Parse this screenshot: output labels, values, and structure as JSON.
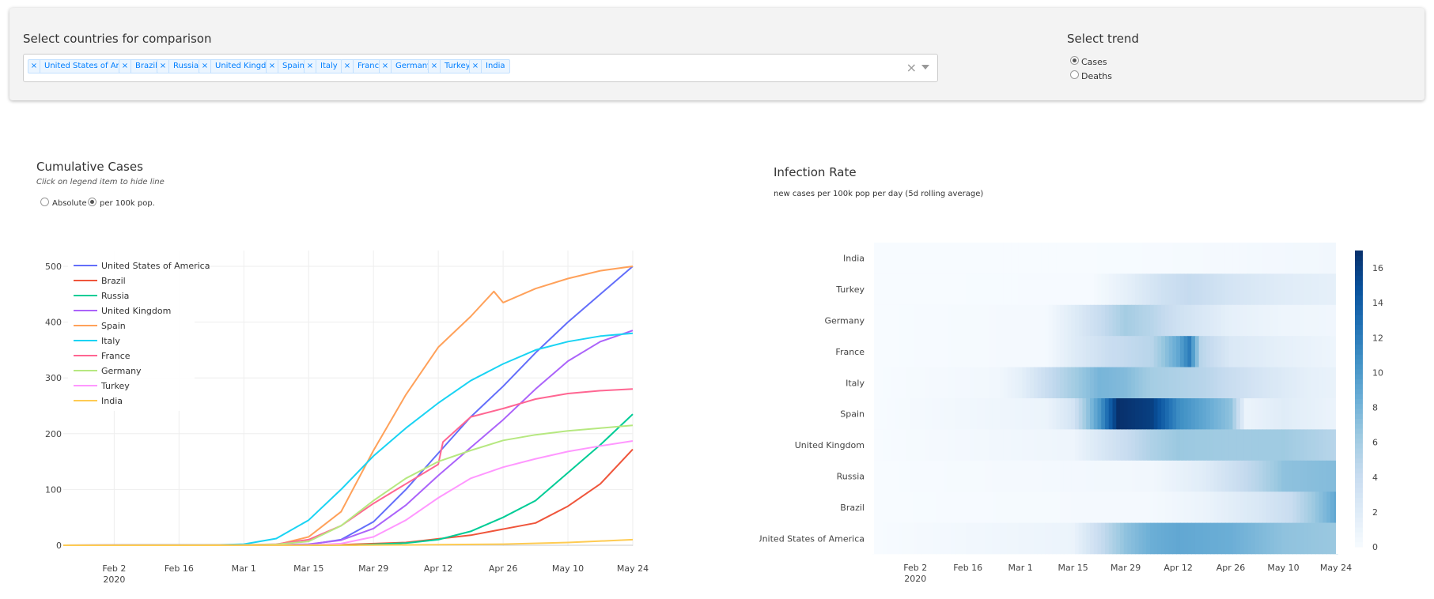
{
  "controls": {
    "country_label": "Select countries for comparison",
    "countries": [
      "United States of America",
      "Brazil",
      "Russia",
      "United Kingdom",
      "Spain",
      "Italy",
      "France",
      "Germany",
      "Turkey",
      "India"
    ],
    "tag_remove": "×",
    "clear_symbol": "×",
    "trend_label": "Select trend",
    "trend_options": [
      "Cases",
      "Deaths"
    ],
    "trend_selected": "Cases"
  },
  "left": {
    "title": "Cumulative Cases",
    "hint": "Click on legend item to hide line",
    "scale_options": [
      "Absolute",
      "per 100k pop."
    ],
    "scale_selected": "per 100k pop."
  },
  "right": {
    "title": "Infection Rate",
    "subtitle": "new cases per 100k pop per day (5d rolling average)"
  },
  "colors": {
    "United States of America": "#636efa",
    "Brazil": "#ef553b",
    "Russia": "#00cc96",
    "United Kingdom": "#ab63fa",
    "Spain": "#ffa15a",
    "Italy": "#19d3f3",
    "France": "#ff6692",
    "Germany": "#b6e880",
    "Turkey": "#ff97ff",
    "India": "#fecb52"
  },
  "chart_data": [
    {
      "type": "line",
      "title": "",
      "xlabel": "",
      "ylabel": "",
      "x_start": "2020-01-22",
      "x_end": "2020-05-24",
      "xticks": [
        "Feb 2",
        "Feb 16",
        "Mar 1",
        "Mar 15",
        "Mar 29",
        "Apr 12",
        "Apr 26",
        "May 10",
        "May 24"
      ],
      "xtick_dates": [
        "2020-02-02",
        "2020-02-16",
        "2020-03-01",
        "2020-03-15",
        "2020-03-29",
        "2020-04-12",
        "2020-04-26",
        "2020-05-10",
        "2020-05-24"
      ],
      "xtick_sublabel": "2020",
      "ylim": [
        0,
        520
      ],
      "yticks": [
        0,
        100,
        200,
        300,
        400,
        500
      ],
      "legend_position": "top-left",
      "series": [
        {
          "name": "United States of America",
          "points": [
            [
              "2020-01-22",
              0
            ],
            [
              "2020-03-10",
              0.3
            ],
            [
              "2020-03-15",
              1
            ],
            [
              "2020-03-22",
              10
            ],
            [
              "2020-03-29",
              42
            ],
            [
              "2020-04-05",
              100
            ],
            [
              "2020-04-12",
              165
            ],
            [
              "2020-04-19",
              230
            ],
            [
              "2020-04-26",
              285
            ],
            [
              "2020-05-03",
              345
            ],
            [
              "2020-05-10",
              400
            ],
            [
              "2020-05-17",
              450
            ],
            [
              "2020-05-24",
              500
            ]
          ]
        },
        {
          "name": "Brazil",
          "points": [
            [
              "2020-01-22",
              0
            ],
            [
              "2020-03-20",
              0.3
            ],
            [
              "2020-04-05",
              5
            ],
            [
              "2020-04-19",
              18
            ],
            [
              "2020-05-03",
              40
            ],
            [
              "2020-05-10",
              70
            ],
            [
              "2020-05-17",
              110
            ],
            [
              "2020-05-24",
              172
            ]
          ]
        },
        {
          "name": "Russia",
          "points": [
            [
              "2020-01-22",
              0
            ],
            [
              "2020-03-25",
              0.3
            ],
            [
              "2020-04-05",
              4
            ],
            [
              "2020-04-12",
              10
            ],
            [
              "2020-04-19",
              25
            ],
            [
              "2020-04-26",
              50
            ],
            [
              "2020-05-03",
              80
            ],
            [
              "2020-05-10",
              130
            ],
            [
              "2020-05-17",
              180
            ],
            [
              "2020-05-24",
              235
            ]
          ]
        },
        {
          "name": "United Kingdom",
          "points": [
            [
              "2020-01-22",
              0
            ],
            [
              "2020-03-08",
              0.5
            ],
            [
              "2020-03-15",
              2
            ],
            [
              "2020-03-22",
              9
            ],
            [
              "2020-03-29",
              30
            ],
            [
              "2020-04-05",
              72
            ],
            [
              "2020-04-12",
              125
            ],
            [
              "2020-04-19",
              175
            ],
            [
              "2020-04-26",
              225
            ],
            [
              "2020-05-03",
              280
            ],
            [
              "2020-05-10",
              330
            ],
            [
              "2020-05-17",
              365
            ],
            [
              "2020-05-24",
              385
            ]
          ]
        },
        {
          "name": "Spain",
          "points": [
            [
              "2020-01-22",
              0
            ],
            [
              "2020-03-08",
              1
            ],
            [
              "2020-03-15",
              15
            ],
            [
              "2020-03-22",
              60
            ],
            [
              "2020-03-29",
              170
            ],
            [
              "2020-04-05",
              270
            ],
            [
              "2020-04-12",
              355
            ],
            [
              "2020-04-19",
              410
            ],
            [
              "2020-04-24",
              455
            ],
            [
              "2020-04-26",
              435
            ],
            [
              "2020-05-03",
              460
            ],
            [
              "2020-05-10",
              478
            ],
            [
              "2020-05-17",
              492
            ],
            [
              "2020-05-24",
              500
            ]
          ]
        },
        {
          "name": "Italy",
          "points": [
            [
              "2020-01-22",
              0
            ],
            [
              "2020-02-24",
              0.5
            ],
            [
              "2020-03-01",
              2
            ],
            [
              "2020-03-08",
              12
            ],
            [
              "2020-03-15",
              45
            ],
            [
              "2020-03-22",
              100
            ],
            [
              "2020-03-29",
              160
            ],
            [
              "2020-04-05",
              210
            ],
            [
              "2020-04-12",
              255
            ],
            [
              "2020-04-19",
              295
            ],
            [
              "2020-04-26",
              325
            ],
            [
              "2020-05-03",
              350
            ],
            [
              "2020-05-10",
              365
            ],
            [
              "2020-05-17",
              375
            ],
            [
              "2020-05-24",
              380
            ]
          ]
        },
        {
          "name": "France",
          "points": [
            [
              "2020-01-22",
              0
            ],
            [
              "2020-03-01",
              0.5
            ],
            [
              "2020-03-08",
              2
            ],
            [
              "2020-03-15",
              10
            ],
            [
              "2020-03-22",
              35
            ],
            [
              "2020-03-29",
              75
            ],
            [
              "2020-04-05",
              110
            ],
            [
              "2020-04-12",
              145
            ],
            [
              "2020-04-13",
              185
            ],
            [
              "2020-04-19",
              230
            ],
            [
              "2020-04-26",
              245
            ],
            [
              "2020-05-03",
              262
            ],
            [
              "2020-05-10",
              272
            ],
            [
              "2020-05-17",
              277
            ],
            [
              "2020-05-24",
              280
            ]
          ]
        },
        {
          "name": "Germany",
          "points": [
            [
              "2020-01-22",
              0
            ],
            [
              "2020-03-01",
              0.3
            ],
            [
              "2020-03-08",
              1.5
            ],
            [
              "2020-03-15",
              7
            ],
            [
              "2020-03-22",
              35
            ],
            [
              "2020-03-29",
              80
            ],
            [
              "2020-04-05",
              120
            ],
            [
              "2020-04-12",
              150
            ],
            [
              "2020-04-19",
              170
            ],
            [
              "2020-04-26",
              188
            ],
            [
              "2020-05-03",
              198
            ],
            [
              "2020-05-10",
              205
            ],
            [
              "2020-05-17",
              210
            ],
            [
              "2020-05-24",
              215
            ]
          ]
        },
        {
          "name": "Turkey",
          "points": [
            [
              "2020-01-22",
              0
            ],
            [
              "2020-03-15",
              0.2
            ],
            [
              "2020-03-22",
              3
            ],
            [
              "2020-03-29",
              15
            ],
            [
              "2020-04-05",
              45
            ],
            [
              "2020-04-12",
              85
            ],
            [
              "2020-04-19",
              120
            ],
            [
              "2020-04-26",
              140
            ],
            [
              "2020-05-03",
              155
            ],
            [
              "2020-05-10",
              168
            ],
            [
              "2020-05-17",
              178
            ],
            [
              "2020-05-24",
              187
            ]
          ]
        },
        {
          "name": "India",
          "points": [
            [
              "2020-01-22",
              0
            ],
            [
              "2020-03-25",
              0.1
            ],
            [
              "2020-04-12",
              1
            ],
            [
              "2020-04-26",
              2
            ],
            [
              "2020-05-10",
              5
            ],
            [
              "2020-05-24",
              10
            ]
          ]
        }
      ]
    },
    {
      "type": "heatmap",
      "title": "",
      "x_start": "2020-01-22",
      "x_end": "2020-05-24",
      "xticks": [
        "Feb 2",
        "Feb 16",
        "Mar 1",
        "Mar 15",
        "Mar 29",
        "Apr 12",
        "Apr 26",
        "May 10",
        "May 24"
      ],
      "xtick_dates": [
        "2020-02-02",
        "2020-02-16",
        "2020-03-01",
        "2020-03-15",
        "2020-03-29",
        "2020-04-12",
        "2020-04-26",
        "2020-05-10",
        "2020-05-24"
      ],
      "xtick_sublabel": "2020",
      "rows": [
        "India",
        "Turkey",
        "Germany",
        "France",
        "Italy",
        "Spain",
        "United Kingdom",
        "Russia",
        "Brazil",
        "United States of America"
      ],
      "zlim": [
        0,
        17
      ],
      "colorbar_ticks": [
        0,
        2,
        4,
        6,
        8,
        10,
        12,
        14,
        16
      ],
      "profiles": {
        "India": [
          [
            "2020-01-22",
            0
          ],
          [
            "2020-04-01",
            0.05
          ],
          [
            "2020-05-24",
            0.5
          ]
        ],
        "Turkey": [
          [
            "2020-01-22",
            0
          ],
          [
            "2020-03-20",
            0.1
          ],
          [
            "2020-03-29",
            1.5
          ],
          [
            "2020-04-08",
            3.5
          ],
          [
            "2020-04-15",
            4.3
          ],
          [
            "2020-04-26",
            3
          ],
          [
            "2020-05-10",
            2
          ],
          [
            "2020-05-24",
            1.5
          ]
        ],
        "Germany": [
          [
            "2020-01-22",
            0
          ],
          [
            "2020-03-08",
            0.3
          ],
          [
            "2020-03-15",
            2
          ],
          [
            "2020-03-22",
            4
          ],
          [
            "2020-03-29",
            6
          ],
          [
            "2020-04-05",
            5
          ],
          [
            "2020-04-12",
            3.5
          ],
          [
            "2020-04-26",
            1.5
          ],
          [
            "2020-05-10",
            0.8
          ],
          [
            "2020-05-24",
            0.6
          ]
        ],
        "France": [
          [
            "2020-01-22",
            0
          ],
          [
            "2020-03-08",
            0.3
          ],
          [
            "2020-03-15",
            2
          ],
          [
            "2020-03-25",
            4
          ],
          [
            "2020-04-05",
            5
          ],
          [
            "2020-04-12",
            9
          ],
          [
            "2020-04-15",
            12
          ],
          [
            "2020-04-18",
            5
          ],
          [
            "2020-04-26",
            2.5
          ],
          [
            "2020-05-10",
            1.5
          ],
          [
            "2020-05-24",
            0.8
          ]
        ],
        "Italy": [
          [
            "2020-01-22",
            0
          ],
          [
            "2020-02-24",
            0.5
          ],
          [
            "2020-03-01",
            1.5
          ],
          [
            "2020-03-08",
            4
          ],
          [
            "2020-03-15",
            6
          ],
          [
            "2020-03-22",
            8
          ],
          [
            "2020-03-29",
            7.5
          ],
          [
            "2020-04-05",
            6
          ],
          [
            "2020-04-19",
            5
          ],
          [
            "2020-05-03",
            3
          ],
          [
            "2020-05-17",
            1.5
          ],
          [
            "2020-05-24",
            1.2
          ]
        ],
        "Spain": [
          [
            "2020-01-22",
            0
          ],
          [
            "2020-03-08",
            1
          ],
          [
            "2020-03-15",
            3
          ],
          [
            "2020-03-22",
            10
          ],
          [
            "2020-03-27",
            17
          ],
          [
            "2020-04-05",
            16
          ],
          [
            "2020-04-12",
            11
          ],
          [
            "2020-04-19",
            9
          ],
          [
            "2020-04-26",
            7
          ],
          [
            "2020-04-30",
            1
          ],
          [
            "2020-05-10",
            2
          ],
          [
            "2020-05-24",
            1
          ]
        ],
        "United Kingdom": [
          [
            "2020-01-22",
            0
          ],
          [
            "2020-03-15",
            0.8
          ],
          [
            "2020-03-22",
            2.5
          ],
          [
            "2020-03-29",
            4
          ],
          [
            "2020-04-05",
            5.5
          ],
          [
            "2020-04-12",
            6.5
          ],
          [
            "2020-04-26",
            6.2
          ],
          [
            "2020-05-10",
            6.3
          ],
          [
            "2020-05-24",
            5
          ]
        ],
        "Russia": [
          [
            "2020-01-22",
            0
          ],
          [
            "2020-04-05",
            0.5
          ],
          [
            "2020-04-19",
            2
          ],
          [
            "2020-05-03",
            5
          ],
          [
            "2020-05-10",
            7
          ],
          [
            "2020-05-24",
            7.5
          ]
        ],
        "Brazil": [
          [
            "2020-01-22",
            0
          ],
          [
            "2020-04-05",
            0.3
          ],
          [
            "2020-04-19",
            1
          ],
          [
            "2020-05-03",
            2.5
          ],
          [
            "2020-05-12",
            4
          ],
          [
            "2020-05-17",
            6
          ],
          [
            "2020-05-24",
            9
          ]
        ],
        "United States of America": [
          [
            "2020-01-22",
            0
          ],
          [
            "2020-03-15",
            1
          ],
          [
            "2020-03-22",
            4
          ],
          [
            "2020-03-29",
            7
          ],
          [
            "2020-04-05",
            8.5
          ],
          [
            "2020-04-12",
            9
          ],
          [
            "2020-04-26",
            8.5
          ],
          [
            "2020-05-10",
            7
          ],
          [
            "2020-05-24",
            6.5
          ]
        ]
      }
    }
  ]
}
